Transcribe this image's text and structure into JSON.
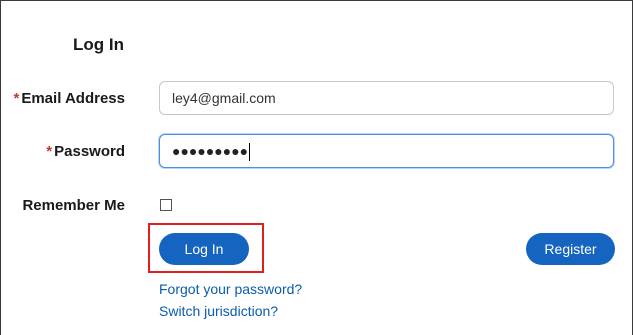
{
  "form": {
    "title": "Log In",
    "email_label": "Email Address",
    "email_value": "ley4@gmail.com",
    "password_label": "Password",
    "password_value": "●●●●●●●●●",
    "remember_label": "Remember Me",
    "remember_checked": false,
    "required_marker": "*"
  },
  "buttons": {
    "login_label": "Log In",
    "register_label": "Register"
  },
  "links": {
    "forgot_password": "Forgot your password?",
    "switch_jurisdiction": "Switch jurisdiction?"
  },
  "colors": {
    "primary": "#1565c0",
    "required": "#c0392b",
    "link": "#0b5cad",
    "highlight": "#e02020"
  }
}
